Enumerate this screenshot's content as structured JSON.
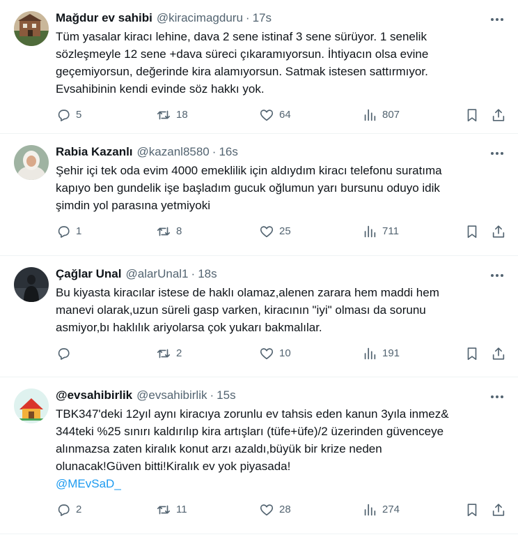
{
  "tweets": [
    {
      "name": "Mağdur ev sahibi",
      "handle": "@kiracimagduru",
      "time": "17s",
      "lines": [
        "Tüm yasalar kiracı lehine, dava 2 sene istinaf 3 sene sürüyor. 1 senelik",
        "sözleşmeyle 12 sene +dava süreci çıkaramıyorsun. İhtiyacın olsa evine",
        "geçemiyorsun, değerinde kira alamıyorsun. Satmak istesen sattırmıyor.",
        "Evsahibinin kendi evinde söz hakkı yok."
      ],
      "replies": "5",
      "retweets": "18",
      "likes": "64",
      "views": "807"
    },
    {
      "name": "Rabia Kazanlı",
      "handle": "@kazanl8580",
      "time": "16s",
      "lines": [
        "Şehir içi tek oda evim 4000 emeklilik için aldıydım kiracı telefonu suratıma",
        "kapıyo ben gundelik işe başladım gucuk oğlumun yarı bursunu oduyo idik",
        "şimdin yol parasına yetmiyoki"
      ],
      "replies": "1",
      "retweets": "8",
      "likes": "25",
      "views": "711"
    },
    {
      "name": "Çağlar Unal",
      "handle": "@alarUnal1",
      "time": "18s",
      "lines": [
        "Bu kiyasta kiracılar istese de haklı olamaz,alenen zarara hem maddi hem",
        "manevi olarak,uzun süreli gasp varken, kiracının \"iyi\" olması da sorunu",
        "asmiyor,bı haklılık ariyolarsa çok yukarı bakmalılar."
      ],
      "replies": "",
      "retweets": "2",
      "likes": "10",
      "views": "191"
    },
    {
      "name": "@evsahibirlik",
      "handle": "@evsahibirlik",
      "time": "15s",
      "lines": [
        "TBK347'deki 12yıl aynı kiracıya zorunlu ev tahsis eden kanun 3yıla inmez&",
        "344teki %25 sınırı kaldırılıp kira artışları (tüfe+üfe)/2 üzerinden güvenceye",
        "alınmazsa zaten kiralık konut arzı azaldı,büyük bir krize neden",
        "olunacak!Güven bitti!Kiralık ev yok piyasada!"
      ],
      "mention": "@MEvSaD_",
      "replies": "2",
      "retweets": "11",
      "likes": "28",
      "views": "274"
    }
  ],
  "colors": {
    "text": "#0f1419",
    "secondary": "#536471",
    "link": "#1d9bf0",
    "divider": "#eff3f4"
  },
  "icons": {
    "more": "more-horizontal-icon",
    "reply": "reply-icon",
    "retweet": "retweet-icon",
    "like": "heart-icon",
    "views": "views-chart-icon",
    "bookmark": "bookmark-icon",
    "share": "share-icon"
  }
}
